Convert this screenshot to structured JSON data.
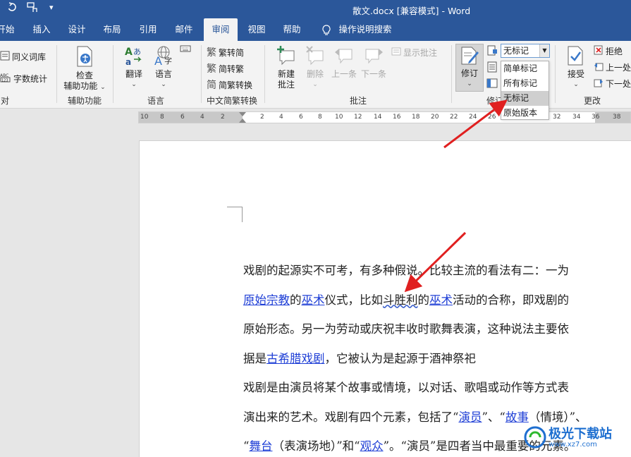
{
  "title_bar": {
    "document_title": "散文.docx [兼容模式] - Word",
    "quick_access": [
      "undo-icon",
      "touch-mode-icon",
      "customize-icon"
    ]
  },
  "tabs": [
    {
      "label": "开始",
      "active": false
    },
    {
      "label": "插入",
      "active": false
    },
    {
      "label": "设计",
      "active": false
    },
    {
      "label": "布局",
      "active": false
    },
    {
      "label": "引用",
      "active": false
    },
    {
      "label": "邮件",
      "active": false
    },
    {
      "label": "审阅",
      "active": true
    },
    {
      "label": "视图",
      "active": false
    },
    {
      "label": "帮助",
      "active": false
    },
    {
      "label": "操作说明搜索",
      "active": false
    }
  ],
  "ribbon": {
    "proofing": {
      "thesaurus": "同义词库",
      "word_count": "字数统计",
      "label": "对"
    },
    "accessibility": {
      "check_line1": "检查",
      "check_line2": "辅助功能",
      "label": "辅助功能"
    },
    "language": {
      "translate": "翻译",
      "language": "语言",
      "label": "语言"
    },
    "chinese_conversion": {
      "to_simplified": "繁转简",
      "to_traditional": "简转繁",
      "convert": "简繁转换",
      "label": "中文简繁转换"
    },
    "comments": {
      "new_line1": "新建",
      "new_line2": "批注",
      "delete": "删除",
      "previous": "上一条",
      "next": "下一条",
      "show_comments": "显示批注",
      "label": "批注"
    },
    "tracking": {
      "track_changes": "修订",
      "label": "修订",
      "markup_selected": "无标记",
      "markup_options": [
        "简单标记",
        "所有标记",
        "无标记",
        "原始版本"
      ]
    },
    "changes": {
      "accept": "接受",
      "reject": "拒绝",
      "previous": "上一处",
      "next": "下一处",
      "label": "更改"
    }
  },
  "ruler": {
    "ticks": [
      "10",
      "8",
      "6",
      "4",
      "2",
      "2",
      "4",
      "6",
      "8",
      "10",
      "12",
      "14",
      "16",
      "18",
      "20",
      "22",
      "24",
      "26",
      "28",
      "30",
      "32",
      "34",
      "36",
      "38"
    ]
  },
  "document": {
    "lines": [
      [
        {
          "t": "戏剧的起源实不可考，有多种假说。比较主流的看法有二：一为"
        }
      ],
      [
        {
          "t": "原始宗教",
          "link": true
        },
        {
          "t": "的"
        },
        {
          "t": "巫术",
          "link": true
        },
        {
          "t": "仪式，比如"
        },
        {
          "t": "斗胜利",
          "squig": true
        },
        {
          "t": "的"
        },
        {
          "t": "巫术",
          "link": true
        },
        {
          "t": "活动的合称，即戏剧的"
        }
      ],
      [
        {
          "t": "原始形态。另一为劳动或庆祝丰收时歌舞表演，这种说法主要依"
        }
      ],
      [
        {
          "t": "据是"
        },
        {
          "t": "古希腊戏剧",
          "link": true
        },
        {
          "t": "，它被认为是起源于酒神祭祀"
        }
      ],
      [
        {
          "t": "戏剧是由演员将某个故事或情境，以对话、歌唱或动作等方式表"
        }
      ],
      [
        {
          "t": "演出来的艺术。戏剧有四个元素，包括了“"
        },
        {
          "t": "演员",
          "link": true
        },
        {
          "t": "”、“"
        },
        {
          "t": "故事",
          "link": true
        },
        {
          "t": "（情境）”、"
        }
      ],
      [
        {
          "t": "“"
        },
        {
          "t": "舞台",
          "link": true
        },
        {
          "t": "（表演场地）”和“"
        },
        {
          "t": "观众",
          "link": true
        },
        {
          "t": "”。“演员”是四者当中最重要的元素。"
        }
      ]
    ]
  },
  "watermark": {
    "text": "极光下载站",
    "sub": "www.xz7.com"
  },
  "colors": {
    "brand": "#2b579a",
    "arrow": "#e02020",
    "link": "#1f3fd6"
  }
}
